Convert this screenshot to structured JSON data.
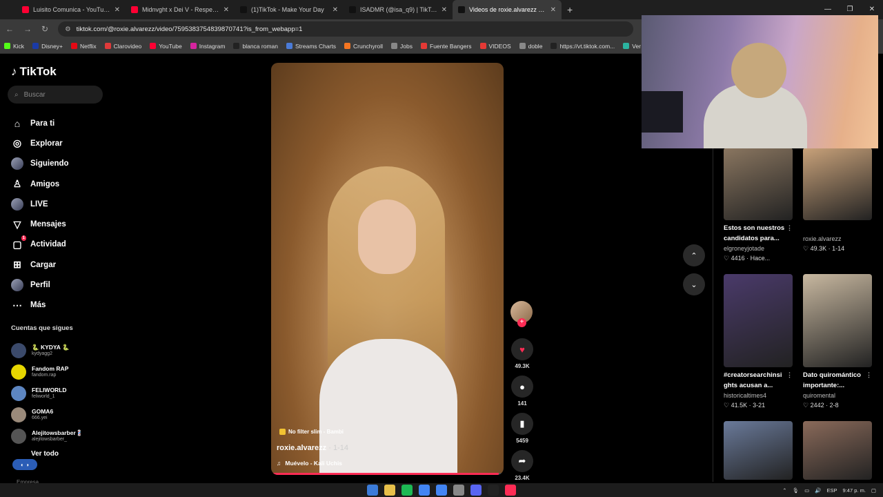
{
  "browser": {
    "tabs": [
      {
        "title": "Luisito Comunica - YouTube",
        "color": "#ff0033"
      },
      {
        "title": "Midnvght x Dei V - Respeto x R",
        "color": "#ff0033"
      },
      {
        "title": "(1)TikTok - Make Your Day",
        "color": "#111111"
      },
      {
        "title": "ISADMR (@isa_q9) | TikTok",
        "color": "#111111"
      },
      {
        "title": "Videos de roxie.alvarezz (@",
        "color": "#111111"
      }
    ],
    "new_tab": "+",
    "url": "tiktok.com/@roxie.alvarezz/video/7595383754839870741?is_from_webapp=1",
    "bookmarks": [
      {
        "label": "Kick",
        "color": "#53fc18"
      },
      {
        "label": "Disney+",
        "color": "#1a3aa6"
      },
      {
        "label": "Netflix",
        "color": "#e50914"
      },
      {
        "label": "Clarovideo",
        "color": "#e03a3a"
      },
      {
        "label": "YouTube",
        "color": "#ff0033"
      },
      {
        "label": "Instagram",
        "color": "#d6249f"
      },
      {
        "label": "blanca roman",
        "color": "#222222"
      },
      {
        "label": "Streams Charts",
        "color": "#4a7bd8"
      },
      {
        "label": "Crunchyroll",
        "color": "#f47521"
      },
      {
        "label": "Jobs",
        "color": "#888888"
      },
      {
        "label": "Fuente Bangers",
        "color": "#e53935"
      },
      {
        "label": "VIDEOS",
        "color": "#e53935"
      },
      {
        "label": "doble",
        "color": "#888888"
      },
      {
        "label": "https://vt.tiktok.com...",
        "color": "#222222"
      },
      {
        "label": "Ver Pa",
        "color": "#2bb3a0"
      }
    ]
  },
  "sidebar": {
    "logo": "TikTok",
    "search_placeholder": "Buscar",
    "nav": [
      {
        "label": "Para ti",
        "icon": "home-icon",
        "glyph": "⌂"
      },
      {
        "label": "Explorar",
        "icon": "compass-icon",
        "glyph": "◎"
      },
      {
        "label": "Siguiendo",
        "icon": "avatar-icon",
        "glyph": ""
      },
      {
        "label": "Amigos",
        "icon": "friends-icon",
        "glyph": "♙"
      },
      {
        "label": "LIVE",
        "icon": "live-avatar-icon",
        "glyph": ""
      },
      {
        "label": "Mensajes",
        "icon": "send-icon",
        "glyph": "▽"
      },
      {
        "label": "Actividad",
        "icon": "activity-icon",
        "glyph": "▢",
        "badge": "1"
      },
      {
        "label": "Cargar",
        "icon": "upload-icon",
        "glyph": "⊞"
      },
      {
        "label": "Perfil",
        "icon": "profile-icon",
        "glyph": ""
      },
      {
        "label": "Más",
        "icon": "more-icon",
        "glyph": "⋯"
      }
    ],
    "following_heading": "Cuentas que sigues",
    "following": [
      {
        "name": "🐍 KYDYA 🐍",
        "user": "kydyagg2",
        "color": "#3b4a6b"
      },
      {
        "name": "Fandom RAP",
        "user": "fandom.rap",
        "color": "#e6d600"
      },
      {
        "name": "FELIWORLD",
        "user": "feliworld_1",
        "color": "#5d86c1"
      },
      {
        "name": "GOMA6",
        "user": "666.yei",
        "color": "#9a8a7a"
      },
      {
        "name": "Alejitowsbarber💈",
        "user": "alejitowsbarber_",
        "color": "#555555"
      }
    ],
    "see_all": "Ver todo",
    "company": "Empresa"
  },
  "video": {
    "tag": "No filter slim - Bambi",
    "username": "roxie.alvarezz",
    "date": "· 1-14",
    "music": "Muévelo - Kali Uchis",
    "progress": 0.98,
    "actions": [
      {
        "name": "like",
        "icon": "heart-icon",
        "glyph": "♥",
        "count": "49.3K",
        "color": "#fe2c55"
      },
      {
        "name": "comment",
        "icon": "comment-icon",
        "glyph": "●",
        "count": "141",
        "color": "#ffffff"
      },
      {
        "name": "save",
        "icon": "bookmark-icon",
        "glyph": "▮",
        "count": "5459",
        "color": "#ffffff"
      },
      {
        "name": "share",
        "icon": "share-icon",
        "glyph": "➦",
        "count": "23.4K",
        "color": "#ffffff"
      }
    ]
  },
  "navigation_arrows": {
    "up": "⌃",
    "down": "⌄"
  },
  "related": [
    {
      "title1": "Estos son nuestros",
      "title2": "candidatos para...",
      "user": "elgroneyjotade",
      "meta": "♡ 4416 · Hace...",
      "color": "#8a7660"
    },
    {
      "title1": "",
      "title2": "",
      "user": "roxie.alvarezz",
      "meta": "♡ 49.3K · 1-14",
      "color": "#c9a27a"
    },
    {
      "title1": "#creatorsearchinsi",
      "title2": "ghts acusan a...",
      "user": "historicaltimes4",
      "meta": "♡ 41.5K · 3-21",
      "color": "#4a3a6a"
    },
    {
      "title1": "Dato quiromántico",
      "title2": "importante:...",
      "user": "quiromental",
      "meta": "♡ 2442 · 2-8",
      "color": "#c8b8a0"
    },
    {
      "title1": "",
      "title2": "",
      "user": "",
      "meta": "",
      "color": "#6a7a9a"
    },
    {
      "title1": "",
      "title2": "",
      "user": "",
      "meta": "",
      "color": "#8a6a5a"
    }
  ],
  "taskbar": {
    "apps": [
      "#3b7bd8",
      "#e8c04a",
      "#1db954",
      "#4285f4",
      "#4285f4",
      "#888888",
      "#5865f2",
      "#222222",
      "#fe2c55"
    ],
    "lang": "ESP",
    "time": "9:47 p. m."
  }
}
